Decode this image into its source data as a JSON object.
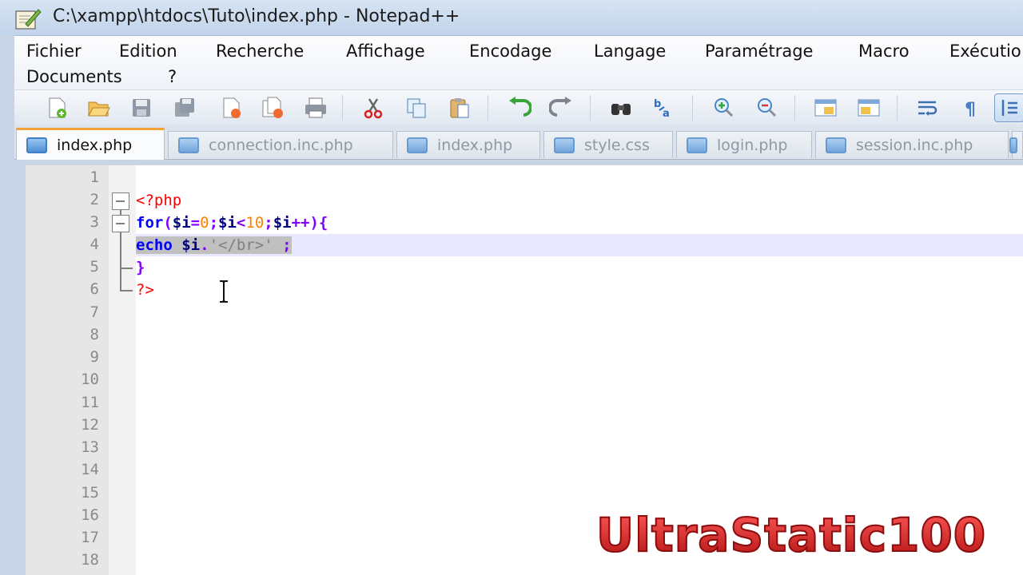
{
  "window": {
    "title": "C:\\xampp\\htdocs\\Tuto\\index.php - Notepad++"
  },
  "menu": [
    {
      "label": "Fichier"
    },
    {
      "label": "Edition"
    },
    {
      "label": "Recherche"
    },
    {
      "label": "Affichage"
    },
    {
      "label": "Encodage"
    },
    {
      "label": "Langage"
    },
    {
      "label": "Paramétrage"
    },
    {
      "label": "Macro"
    },
    {
      "label": "Exécutio"
    },
    {
      "label": "Documents"
    },
    {
      "label": "?"
    }
  ],
  "toolbar": {
    "icons": [
      "new-file-icon",
      "open-folder-icon",
      "save-icon",
      "save-all-icon",
      "close-icon",
      "close-all-icon",
      "print-icon",
      "cut-icon",
      "copy-icon",
      "paste-icon",
      "undo-icon",
      "redo-icon",
      "find-icon",
      "replace-icon",
      "zoom-in-icon",
      "zoom-out-icon",
      "sync-vertical-icon",
      "sync-horizontal-icon",
      "word-wrap-icon",
      "show-all-chars-icon",
      "indent-guide-icon"
    ]
  },
  "tabs": [
    {
      "label": "index.php",
      "active": true
    },
    {
      "label": "connection.inc.php",
      "active": false
    },
    {
      "label": "index.php",
      "active": false
    },
    {
      "label": "style.css",
      "active": false
    },
    {
      "label": "login.php",
      "active": false
    },
    {
      "label": "session.inc.php",
      "active": false
    }
  ],
  "editor": {
    "line_numbers": [
      "1",
      "2",
      "3",
      "4",
      "5",
      "6",
      "7",
      "8",
      "9",
      "10",
      "11",
      "12",
      "13",
      "14",
      "15",
      "16",
      "17",
      "18"
    ],
    "code": {
      "l2_open": "<?php",
      "l3_for": "for",
      "l3_paren": "(",
      "l3_var1": "$i",
      "l3_eq": "=",
      "l3_zero": "0",
      "l3_semi1": ";",
      "l3_var2": "$i",
      "l3_lt": "<",
      "l3_ten": "10",
      "l3_semi2": ";",
      "l3_var3": "$i",
      "l3_inc": "++){",
      "l4_echo": "echo",
      "l4_sp": " ",
      "l4_var": "$i",
      "l4_dot": ".",
      "l4_str": "'</br>'",
      "l4_end": " ;",
      "l5_brace": "}",
      "l6_close": "?>"
    }
  },
  "watermark": {
    "text": "UltraStatic100"
  },
  "colors": {
    "active_tab_accent": "#f5a23a",
    "keyword": "#0000ff",
    "php_tag": "#ff0000",
    "number": "#ff8000",
    "string": "#808080",
    "selection": "#c0c0c0"
  }
}
